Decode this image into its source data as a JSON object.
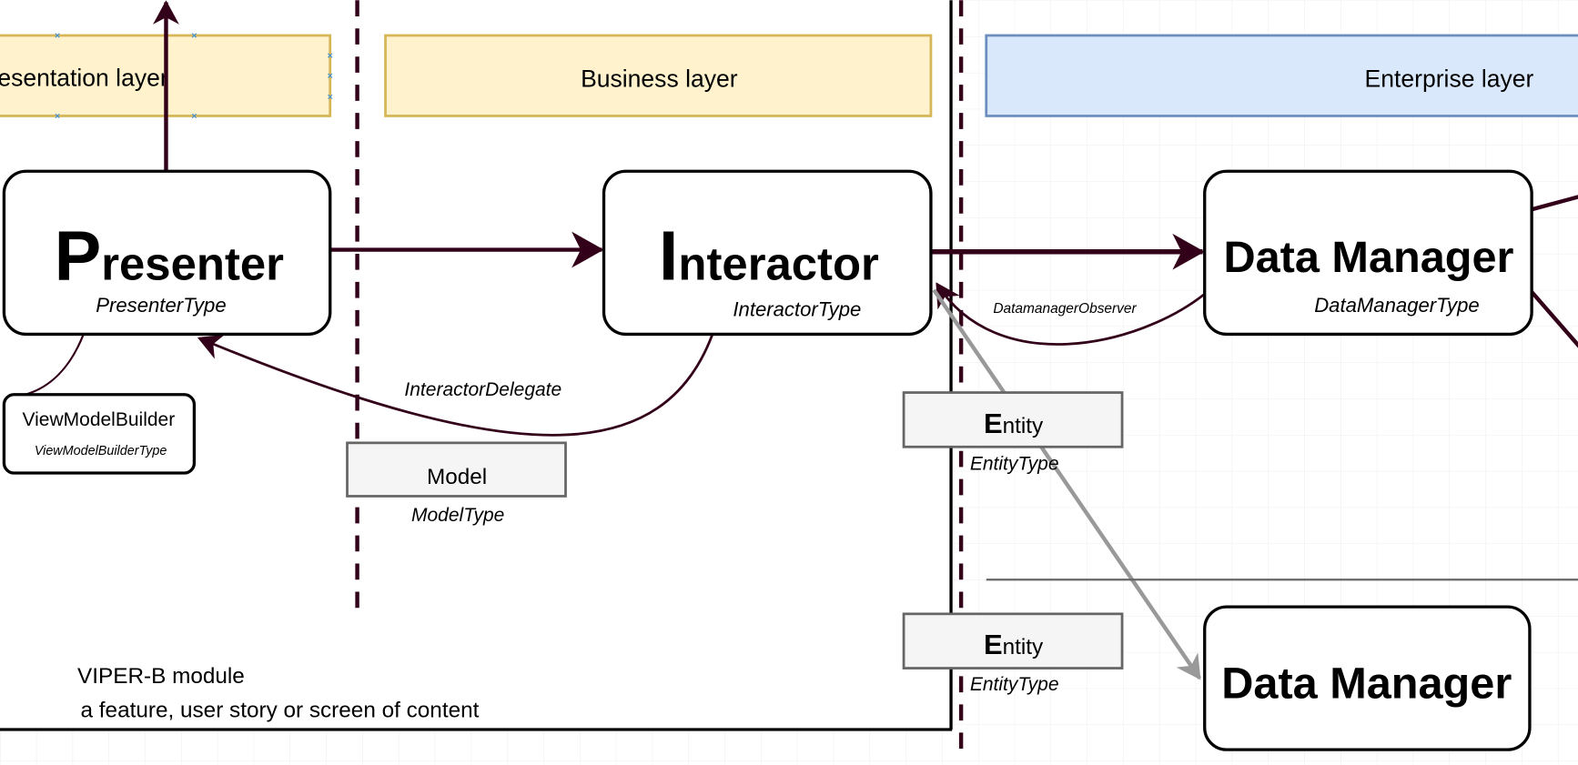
{
  "layers": {
    "presentation": "Presentation layer",
    "business": "Business layer",
    "enterprise": "Enterprise layer"
  },
  "presenter": {
    "initial": "P",
    "rest": "resenter",
    "type": "PresenterType"
  },
  "interactor": {
    "initial": "I",
    "rest": "nteractor",
    "type": "InteractorType"
  },
  "data_manager": {
    "title": "Data Manager",
    "type": "DataManagerType"
  },
  "data_manager_2": {
    "title": "Data Manager"
  },
  "view_model_builder": {
    "title": "ViewModelBuilder",
    "type": "ViewModelBuilderType"
  },
  "model": {
    "title": "Model",
    "type": "ModelType"
  },
  "entity_1": {
    "initial": "E",
    "rest": "ntity",
    "type": "EntityType"
  },
  "entity_2": {
    "initial": "E",
    "rest": "ntity",
    "type": "EntityType"
  },
  "edges": {
    "interactor_delegate": "InteractorDelegate",
    "datamanager_observer": "DatamanagerObserver"
  },
  "module": {
    "title": "VIPER-B module",
    "subtitle": "a feature, user story or screen of content"
  },
  "colors": {
    "flow": "#33001a",
    "business_fill": "#fff2cc",
    "business_stroke": "#d6b656",
    "enterprise_fill": "#dae8fc",
    "enterprise_stroke": "#6c8ebf",
    "entity_fill": "#f5f5f5",
    "entity_link": "#999999"
  }
}
